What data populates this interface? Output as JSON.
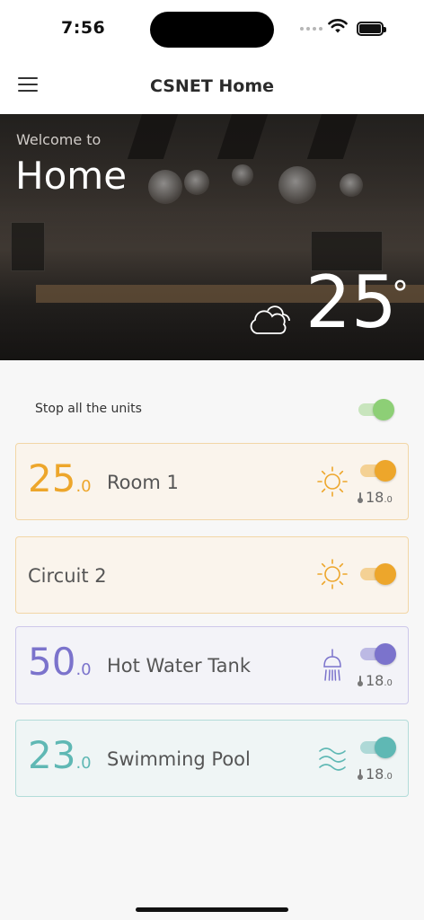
{
  "status_bar": {
    "time": "7:56"
  },
  "nav": {
    "title": "CSNET Home"
  },
  "hero": {
    "welcome": "Welcome to",
    "title": "Home",
    "temperature": "25",
    "degree_symbol": "°",
    "weather_icon": "cloudy-icon"
  },
  "stop_all": {
    "label": "Stop all the units",
    "on": true,
    "color": "#8dcf76"
  },
  "units": [
    {
      "temp_int": "25",
      "temp_dec": ".0",
      "name": "Room 1",
      "icon": "sun-icon",
      "accent": "#eda62b",
      "on": true,
      "setpoint_int": "18",
      "setpoint_dec": ".0"
    },
    {
      "name": "Circuit 2",
      "icon": "sun-icon",
      "accent": "#eda62b",
      "on": true
    },
    {
      "temp_int": "50",
      "temp_dec": ".0",
      "name": "Hot Water Tank",
      "icon": "shower-icon",
      "accent": "#7b73cc",
      "on": true,
      "setpoint_int": "18",
      "setpoint_dec": ".0"
    },
    {
      "temp_int": "23",
      "temp_dec": ".0",
      "name": "Swimming Pool",
      "icon": "waves-icon",
      "accent": "#5fb8b4",
      "on": true,
      "setpoint_int": "18",
      "setpoint_dec": ".0"
    }
  ]
}
